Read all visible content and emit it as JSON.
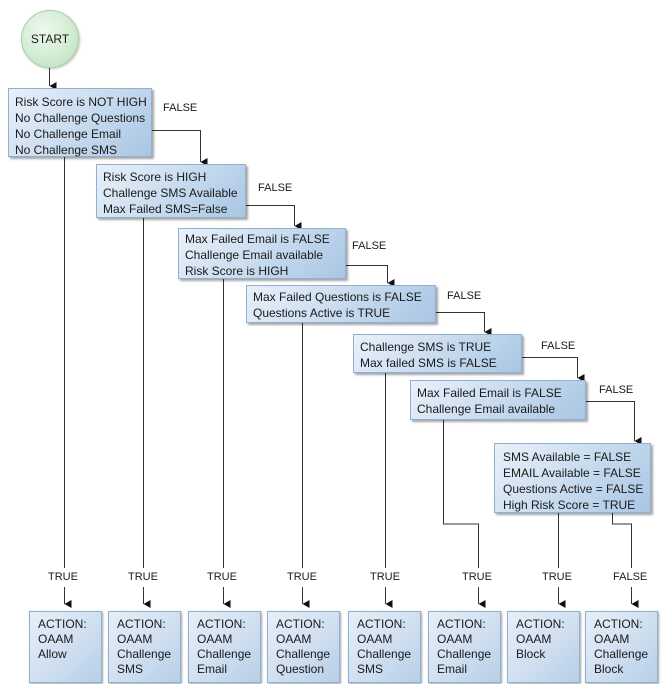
{
  "start": {
    "label": "START"
  },
  "conditions": [
    {
      "lines": [
        "Risk Score is NOT HIGH",
        "No Challenge Questions",
        "No Challenge Email",
        "No Challenge SMS"
      ]
    },
    {
      "lines": [
        "Risk Score is HIGH",
        "Challenge SMS Available",
        "Max Failed SMS=False"
      ]
    },
    {
      "lines": [
        "Max Failed Email is FALSE",
        "Challenge Email available",
        "Risk Score is HIGH"
      ]
    },
    {
      "lines": [
        "Max Failed Questions is FALSE",
        "Questions Active is TRUE"
      ]
    },
    {
      "lines": [
        "Challenge SMS is TRUE",
        "Max failed SMS is FALSE"
      ]
    },
    {
      "lines": [
        "Max Failed Email is FALSE",
        "Challenge Email available"
      ]
    },
    {
      "lines": [
        "SMS Available = FALSE",
        "EMAIL Available = FALSE",
        "Questions Active = FALSE",
        "High Risk Score = TRUE"
      ]
    }
  ],
  "false_labels": [
    "FALSE",
    "FALSE",
    "FALSE",
    "FALSE",
    "FALSE",
    "FALSE"
  ],
  "branch_labels": [
    "TRUE",
    "TRUE",
    "TRUE",
    "TRUE",
    "TRUE",
    "TRUE",
    "TRUE",
    "FALSE"
  ],
  "actions": [
    {
      "lines": [
        "ACTION:",
        "OAAM",
        "Allow"
      ]
    },
    {
      "lines": [
        "ACTION:",
        "OAAM",
        "Challenge",
        "SMS"
      ]
    },
    {
      "lines": [
        "ACTION:",
        "OAAM",
        "Challenge",
        "Email"
      ]
    },
    {
      "lines": [
        "ACTION:",
        "OAAM",
        "Challenge",
        "Question"
      ]
    },
    {
      "lines": [
        "ACTION:",
        "OAAM",
        "Challenge",
        "SMS"
      ]
    },
    {
      "lines": [
        "ACTION:",
        "OAAM",
        "Challenge",
        "Email"
      ]
    },
    {
      "lines": [
        "ACTION:",
        "OAAM",
        "Block"
      ]
    },
    {
      "lines": [
        "ACTION:",
        "OAAM",
        "Challenge",
        "Block"
      ]
    }
  ]
}
